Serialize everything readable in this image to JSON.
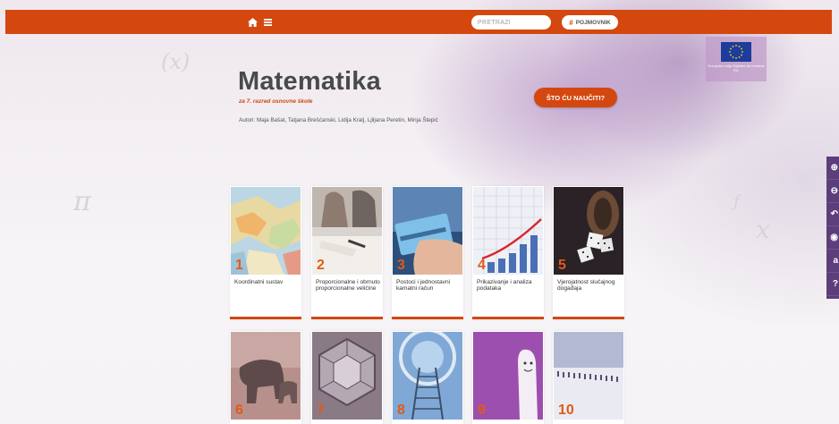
{
  "header": {
    "search_placeholder": "PRETRAŽI",
    "glossary_label": "POJMOVNIK",
    "glossary_symbol": "#"
  },
  "hero": {
    "title": "Matematika",
    "subtitle": "za 7. razred osnovne škole",
    "authors": "Autori: Maja Bašat, Tatjana Brešćanski, Lidija Kralj, Ljiljana Peretin, Minja Štepić",
    "cta_label": "ŠTO ĆU NAUČITI?"
  },
  "eu_badge": {
    "text": "Europska unija Zajedno do fondova EU"
  },
  "side_toolbar": {
    "items": [
      "⊕",
      "⊖",
      "↶",
      "◉",
      "a",
      "?"
    ]
  },
  "cards": [
    {
      "number": "1",
      "label": "Koordinatni sustav"
    },
    {
      "number": "2",
      "label": "Proporcionalne i obrnuto proporcionalne veličine"
    },
    {
      "number": "3",
      "label": "Postoci i jednostavni kamatni račun"
    },
    {
      "number": "4",
      "label": "Prikazivanje i analiza podataka"
    },
    {
      "number": "5",
      "label": "Vjerojatnost slučajnog događaja"
    },
    {
      "number": "6",
      "label": ""
    },
    {
      "number": "7",
      "label": ""
    },
    {
      "number": "8",
      "label": ""
    },
    {
      "number": "9",
      "label": ""
    },
    {
      "number": "10",
      "label": ""
    }
  ],
  "colors": {
    "accent": "#d4470f",
    "toolbar": "#5c3f7a"
  }
}
